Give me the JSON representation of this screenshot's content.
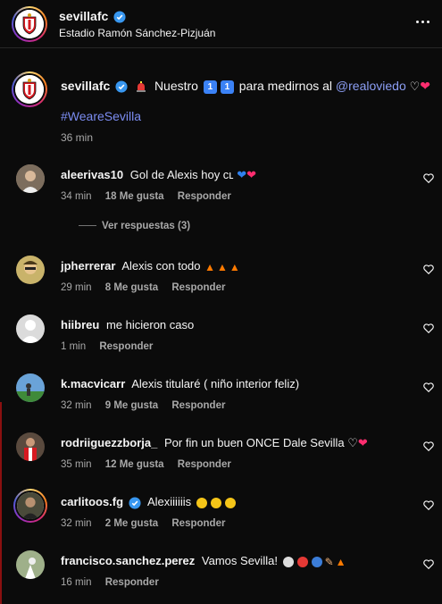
{
  "header": {
    "username": "sevillafc",
    "location": "Estadio Ramón Sánchez-Pizjuán"
  },
  "caption": {
    "username": "sevillafc",
    "text_a": "Nuestro",
    "key1": "1",
    "key2": "1",
    "text_b": "para medirnos al",
    "mention": "@realoviedo",
    "hashtag": "#WeareSevilla",
    "time": "36 min"
  },
  "comments": [
    {
      "user": "aleerivas10",
      "text": "Gol de Alexis hoy ᴄʟ",
      "time": "34 min",
      "likes": "18 Me gusta",
      "reply": "Responder"
    },
    {
      "user": "jpherrerar",
      "text": "Alexis con todo",
      "time": "29 min",
      "likes": "8 Me gusta",
      "reply": "Responder"
    },
    {
      "user": "hiibreu",
      "text": "me hicieron caso",
      "time": "1 min",
      "likes": "",
      "reply": "Responder"
    },
    {
      "user": "k.macvicarr",
      "text": "Alexis titularé ( niño interior feliz)",
      "time": "32 min",
      "likes": "9 Me gusta",
      "reply": "Responder"
    },
    {
      "user": "rodriiguezzborja_",
      "text": "Por fin un buen ONCE Dale Sevilla",
      "time": "35 min",
      "likes": "12 Me gusta",
      "reply": "Responder"
    },
    {
      "user": "carlitoos.fg",
      "text": "Alexiiiiiis",
      "time": "32 min",
      "likes": "2 Me gusta",
      "reply": "Responder"
    },
    {
      "user": "francisco.sanchez.perez",
      "text": "Vamos Sevilla!",
      "time": "16 min",
      "likes": "",
      "reply": "Responder"
    }
  ],
  "view_replies": "Ver respuestas (3)",
  "colors": {
    "accent_link": "#8c9ff5",
    "verified": "#3897f0",
    "sevilla_red": "#d71920"
  }
}
